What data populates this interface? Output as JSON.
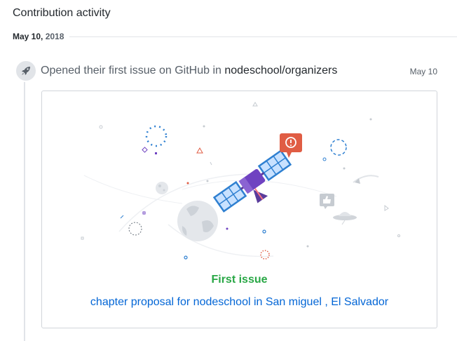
{
  "section": {
    "title": "Contribution activity"
  },
  "date_group": {
    "month_day": "May 10,",
    "year": "2018"
  },
  "event": {
    "icon": "rocket-icon",
    "prefix": "Opened their first issue on GitHub in ",
    "repo": "nodeschool/organizers",
    "date": "May 10"
  },
  "card": {
    "title": "First issue",
    "link_text": "chapter proposal for nodeschool in San miguel , El Salvador",
    "colors": {
      "title": "#28a745",
      "link": "#0366d6"
    }
  }
}
